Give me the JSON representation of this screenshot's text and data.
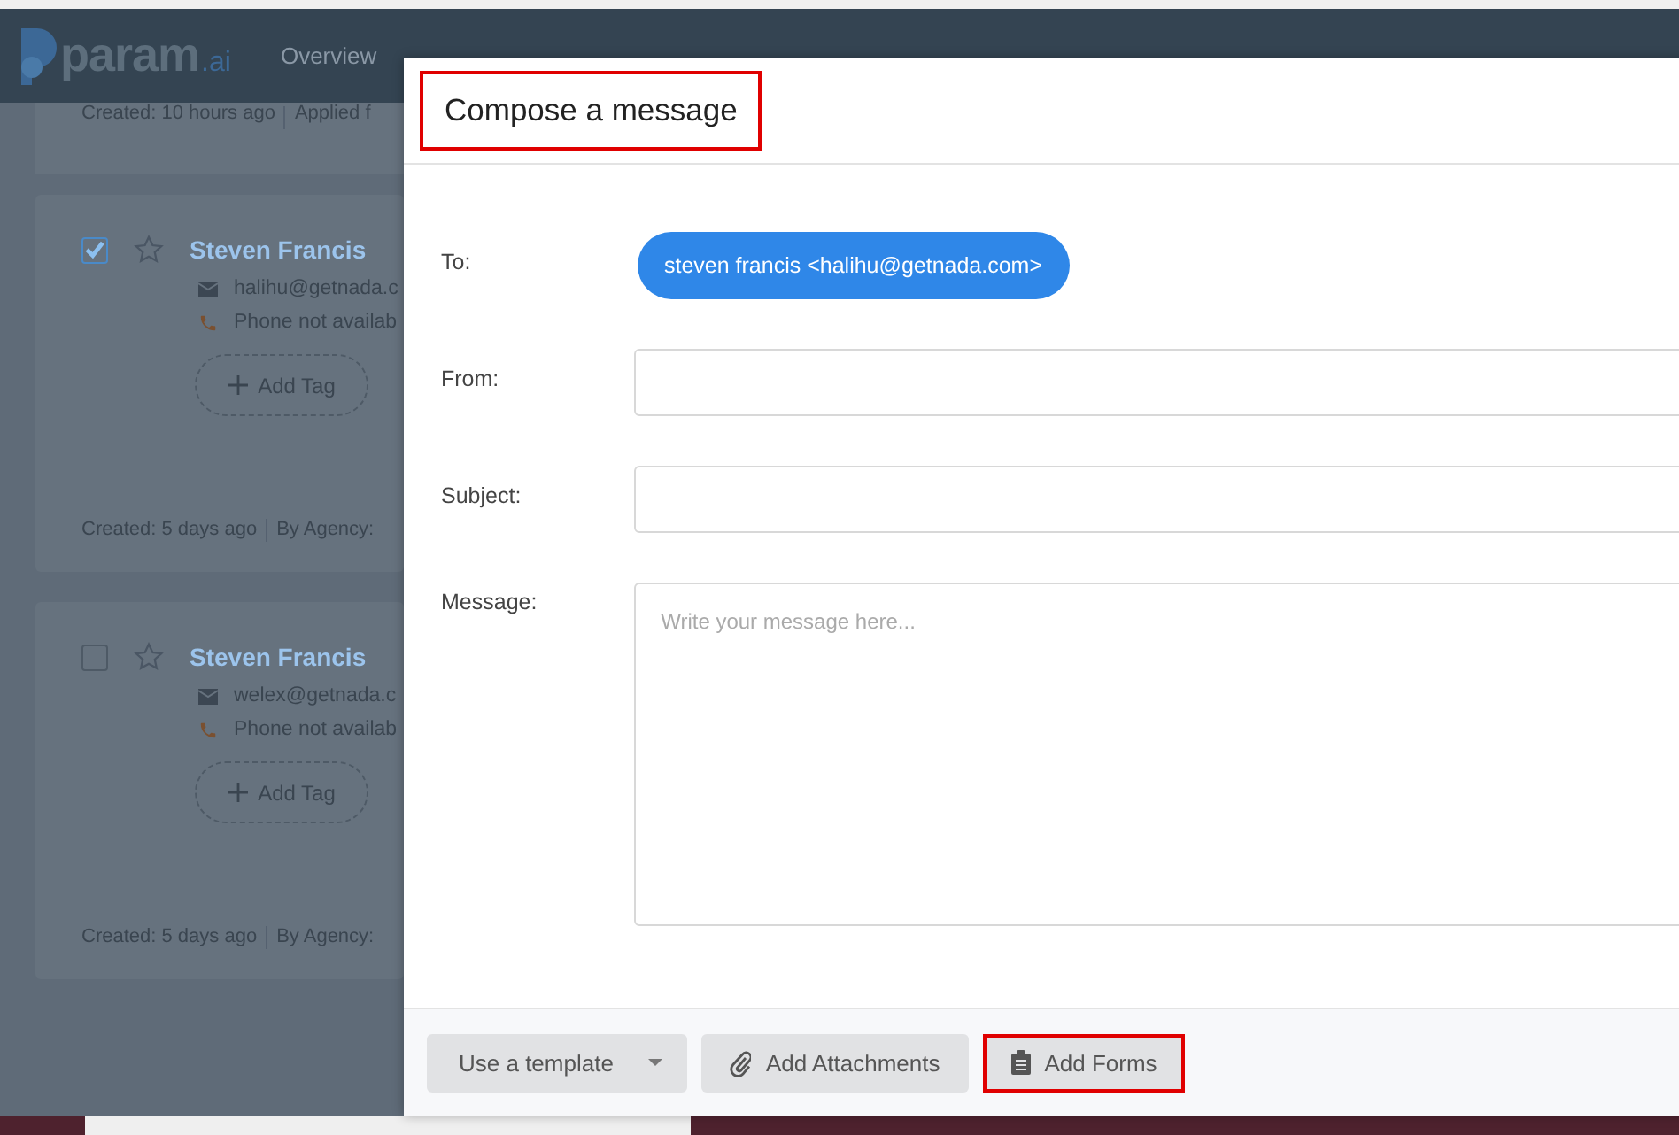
{
  "nav": {
    "logo": "param",
    "logo_suffix": ".ai",
    "items": [
      "Overview"
    ]
  },
  "previous_card": {
    "meta": [
      "Created: 10 hours ago",
      "Applied f"
    ]
  },
  "cards": [
    {
      "checked": true,
      "name": "Steven Francis",
      "email": "halihu@getnada.c",
      "phone": "Phone not availab",
      "tag_button": "Add Tag",
      "meta": [
        "Created: 5 days ago",
        "By Agency:"
      ]
    },
    {
      "checked": false,
      "name": "Steven Francis",
      "email": "welex@getnada.c",
      "phone": "Phone not availab",
      "tag_button": "Add Tag",
      "meta": [
        "Created: 5 days ago",
        "By Agency:"
      ]
    }
  ],
  "modal": {
    "title": "Compose a message",
    "title_highlighted": true,
    "fields": [
      {
        "label": "To:",
        "kind": "recipient",
        "chips": [
          "steven francis <halihu@getnada.com>"
        ]
      },
      {
        "label": "From:",
        "kind": "input"
      },
      {
        "label": "Subject:",
        "kind": "input"
      },
      {
        "label": "Message:",
        "kind": "textarea",
        "placeholder": "Write your message here..."
      }
    ],
    "buttons": [
      {
        "label": "Use a template",
        "kind": "dropdown",
        "highlighted": false
      },
      {
        "label": "Add Attachments",
        "kind": "attach",
        "highlighted": false
      },
      {
        "label": "Add Forms",
        "kind": "forms",
        "highlighted": true
      }
    ]
  }
}
